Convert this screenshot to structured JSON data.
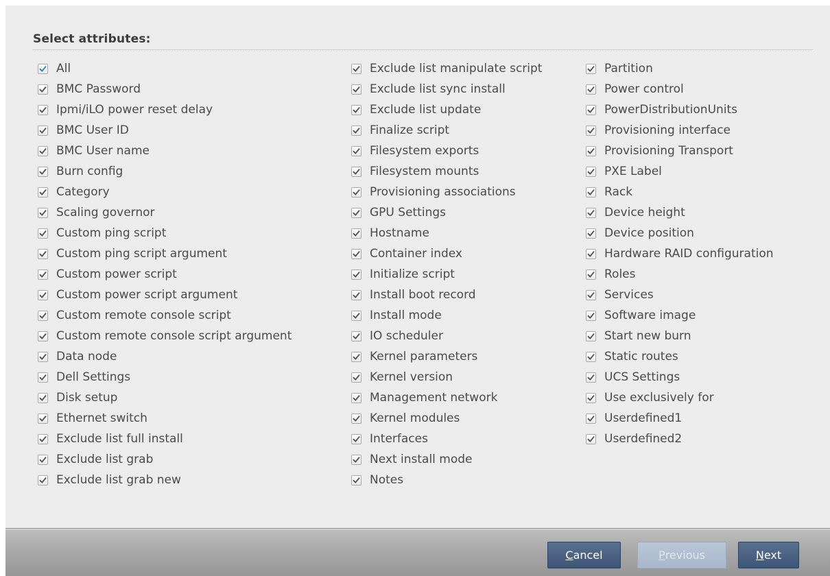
{
  "dialog": {
    "section_title": "Select attributes:"
  },
  "attributes": {
    "column1": [
      {
        "label": "All",
        "checked": true,
        "highlight": true
      },
      {
        "label": "BMC Password",
        "checked": true
      },
      {
        "label": "Ipmi/iLO power reset delay",
        "checked": true
      },
      {
        "label": "BMC User ID",
        "checked": true
      },
      {
        "label": "BMC User name",
        "checked": true
      },
      {
        "label": "Burn config",
        "checked": true
      },
      {
        "label": "Category",
        "checked": true
      },
      {
        "label": "Scaling governor",
        "checked": true
      },
      {
        "label": "Custom ping script",
        "checked": true
      },
      {
        "label": "Custom ping script argument",
        "checked": true
      },
      {
        "label": "Custom power script",
        "checked": true
      },
      {
        "label": "Custom power script argument",
        "checked": true
      },
      {
        "label": "Custom remote console script",
        "checked": true
      },
      {
        "label": "Custom remote console script argument",
        "checked": true
      },
      {
        "label": "Data node",
        "checked": true
      },
      {
        "label": "Dell Settings",
        "checked": true
      },
      {
        "label": "Disk setup",
        "checked": true
      },
      {
        "label": "Ethernet switch",
        "checked": true
      },
      {
        "label": "Exclude list full install",
        "checked": true
      },
      {
        "label": "Exclude list grab",
        "checked": true
      },
      {
        "label": "Exclude list grab new",
        "checked": true
      }
    ],
    "column2": [
      {
        "label": "Exclude list manipulate script",
        "checked": true
      },
      {
        "label": "Exclude list sync install",
        "checked": true
      },
      {
        "label": "Exclude list update",
        "checked": true
      },
      {
        "label": "Finalize script",
        "checked": true
      },
      {
        "label": "Filesystem exports",
        "checked": true
      },
      {
        "label": "Filesystem mounts",
        "checked": true
      },
      {
        "label": "Provisioning associations",
        "checked": true
      },
      {
        "label": "GPU Settings",
        "checked": true
      },
      {
        "label": "Hostname",
        "checked": true
      },
      {
        "label": "Container index",
        "checked": true
      },
      {
        "label": "Initialize script",
        "checked": true
      },
      {
        "label": "Install boot record",
        "checked": true
      },
      {
        "label": "Install mode",
        "checked": true
      },
      {
        "label": "IO scheduler",
        "checked": true
      },
      {
        "label": "Kernel parameters",
        "checked": true
      },
      {
        "label": "Kernel version",
        "checked": true
      },
      {
        "label": "Management network",
        "checked": true
      },
      {
        "label": "Kernel modules",
        "checked": true
      },
      {
        "label": "Interfaces",
        "checked": true
      },
      {
        "label": "Next install mode",
        "checked": true
      },
      {
        "label": "Notes",
        "checked": true
      }
    ],
    "column3": [
      {
        "label": "Partition",
        "checked": true
      },
      {
        "label": "Power control",
        "checked": true
      },
      {
        "label": "PowerDistributionUnits",
        "checked": true
      },
      {
        "label": "Provisioning interface",
        "checked": true
      },
      {
        "label": "Provisioning Transport",
        "checked": true
      },
      {
        "label": "PXE Label",
        "checked": true
      },
      {
        "label": "Rack",
        "checked": true
      },
      {
        "label": "Device height",
        "checked": true
      },
      {
        "label": "Device position",
        "checked": true
      },
      {
        "label": "Hardware RAID configuration",
        "checked": true
      },
      {
        "label": "Roles",
        "checked": true
      },
      {
        "label": "Services",
        "checked": true
      },
      {
        "label": "Software image",
        "checked": true
      },
      {
        "label": "Start new burn",
        "checked": true
      },
      {
        "label": "Static routes",
        "checked": true
      },
      {
        "label": "UCS Settings",
        "checked": true
      },
      {
        "label": "Use exclusively for",
        "checked": true
      },
      {
        "label": "Userdefined1",
        "checked": true
      },
      {
        "label": "Userdefined2",
        "checked": true
      }
    ]
  },
  "footer": {
    "cancel": {
      "mnemonic": "C",
      "rest": "ancel",
      "enabled": true
    },
    "previous": {
      "mnemonic": "P",
      "rest": "revious",
      "enabled": false
    },
    "next": {
      "mnemonic": "N",
      "rest": "ext",
      "enabled": true
    }
  },
  "colors": {
    "check_normal": "#555555",
    "check_highlight": "#2f7fd0",
    "button_active": "#4a6282",
    "button_disabled": "#b0bfd1"
  },
  "icons": {
    "checkbox_mark": "check-icon"
  }
}
